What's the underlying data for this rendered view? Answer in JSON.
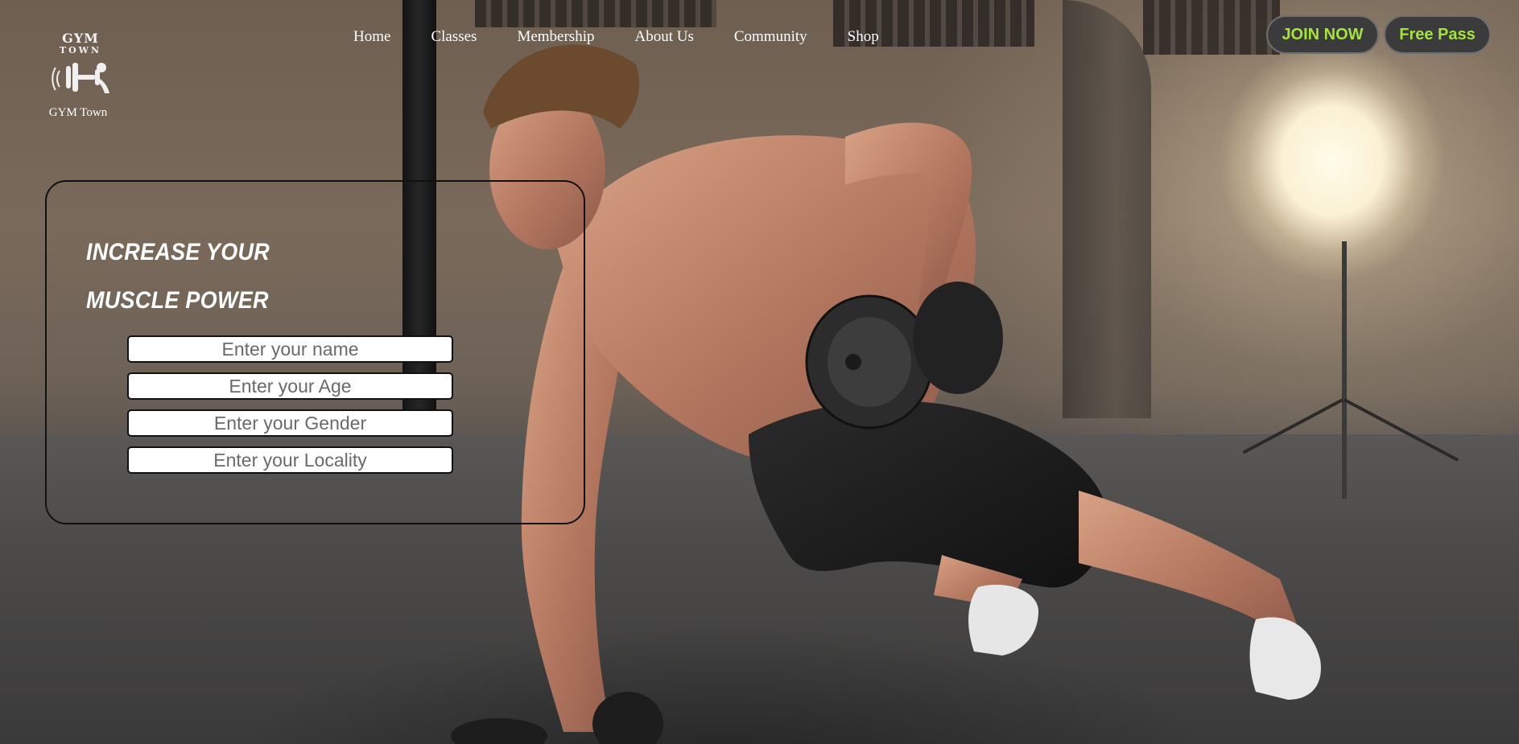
{
  "brand": {
    "logo_line1": "GYM",
    "logo_line2": "TOWN",
    "name": "GYM Town"
  },
  "nav": {
    "items": [
      {
        "label": "Home"
      },
      {
        "label": "Classes"
      },
      {
        "label": "Membership"
      },
      {
        "label": "About Us"
      },
      {
        "label": "Community"
      },
      {
        "label": "Shop"
      }
    ]
  },
  "actions": {
    "join_label": "JOIN NOW",
    "free_pass_label": "Free Pass",
    "accent_color": "#a4e43b"
  },
  "hero": {
    "headline_line1": "INCREASE YOUR",
    "headline_line2": "MUSCLE POWER"
  },
  "form": {
    "name_placeholder": "Enter your name",
    "age_placeholder": "Enter your Age",
    "gender_placeholder": "Enter your Gender",
    "locality_placeholder": "Enter your Locality"
  }
}
